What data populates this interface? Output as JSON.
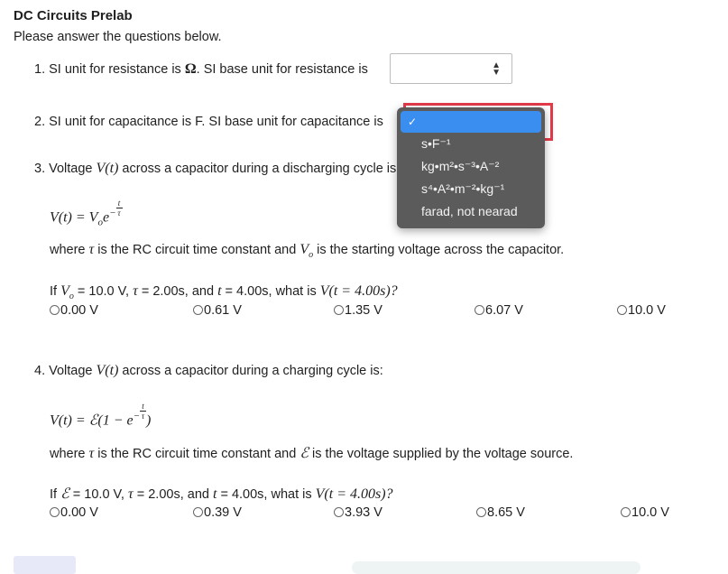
{
  "header": {
    "title": "DC Circuits Prelab",
    "subtitle": "Please answer the questions below."
  },
  "q1": {
    "prefix": "1. SI unit for resistance is ",
    "unit": "Ω",
    "suffix": ". SI base unit for resistance is",
    "select_value": ""
  },
  "q2": {
    "text": "2. SI unit for capacitance is F. SI base unit for capacitance is",
    "dropdown": {
      "options": [
        "",
        "s•F⁻¹",
        "kg•m²•s⁻³•A⁻²",
        "s⁴•A²•m⁻²•kg⁻¹",
        "farad, not nearad"
      ],
      "check": "✓"
    }
  },
  "q3": {
    "prefix": "3. Voltage ",
    "vt": "V(t)",
    "suffix": " across a capacitor during a discharging cycle is:",
    "eq_lhs": "V(t) = V",
    "eq_sub": "o",
    "eq_e": "e",
    "eq_num": "t",
    "eq_den": "τ",
    "where_prefix": "where ",
    "tau": "τ",
    "where_mid": " is the RC circuit time constant and ",
    "vo": "V",
    "vo_sub": "o",
    "where_suffix": " is the starting voltage across the capacitor.",
    "given_prefix": "If ",
    "given_mid1": " = 10.0 V, ",
    "given_mid2": " = 2.00s, and ",
    "t": "t",
    "given_mid3": " = 4.00s, what is ",
    "ask": "V(t = 4.00s)?",
    "options": [
      "0.00 V",
      "0.61 V",
      "1.35 V",
      "6.07 V",
      "10.0 V"
    ]
  },
  "q4": {
    "prefix": "4. Voltage ",
    "vt": "V(t)",
    "suffix": " across a capacitor during a charging cycle is:",
    "eq": "V(t) = ℰ(1 − e",
    "eq_close": ")",
    "eq_num": "t",
    "eq_den": "τ",
    "where_prefix": "where ",
    "tau": "τ",
    "where_mid": " is the RC circuit time constant and ",
    "emf": "ℰ",
    "where_suffix": " is the voltage supplied by the voltage source.",
    "given_prefix": "If ",
    "given_mid1": " = 10.0 V, ",
    "given_mid2": " = 2.00s, and ",
    "t": "t",
    "given_mid3": " = 4.00s, what is ",
    "ask": "V(t = 4.00s)?",
    "options": [
      "0.00 V",
      "0.39 V",
      "3.93 V",
      "8.65 V",
      "10.0 V"
    ]
  },
  "icons": {
    "select_arrow": "select-arrows-icon",
    "radio": "radio-button-icon"
  },
  "colors": {
    "highlight": "#e53a4a",
    "dropdown_bg": "#5b5b5b",
    "selected": "#3a8ef0"
  }
}
